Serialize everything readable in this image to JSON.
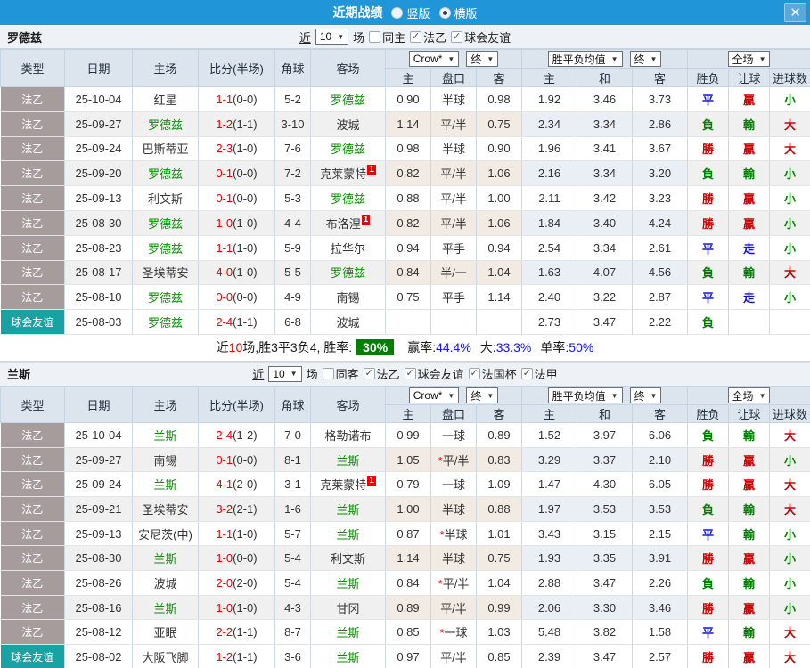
{
  "colors": {
    "accent": "#2095d8",
    "league_type_bg": "#a69c9c",
    "friendly_type_bg": "#17a3a3",
    "team_highlight": "#089000",
    "score_red": "#e80000",
    "badge_bg": "#f40000",
    "rate_badge_bg": "#008000",
    "stat_blue": "#1414e8",
    "result_map": {
      "勝": "#cc0000",
      "負": "#008000",
      "平": "#1414d8",
      "贏": "#cc0000",
      "輸": "#008000",
      "走": "#1414d8",
      "大": "#cc0000",
      "小": "#008000"
    }
  },
  "titlebar": {
    "title": "近期战绩",
    "options": [
      {
        "label": "竖版",
        "selected": false
      },
      {
        "label": "横版",
        "selected": true
      }
    ],
    "close_icon": "✕"
  },
  "controls": {
    "near": "近",
    "count": "10",
    "matches": "场"
  },
  "table_header": {
    "type": "类型",
    "date": "日期",
    "home": "主场",
    "score": "比分(半场)",
    "corner": "角球",
    "away": "客场",
    "odds_select": "Crow*",
    "final_select": "终",
    "avg_select": "胜平负均值",
    "full_select": "全场",
    "sub": [
      "主",
      "盘口",
      "客",
      "主",
      "和",
      "客",
      "胜负",
      "让球",
      "进球数"
    ]
  },
  "teams": [
    {
      "name": "罗德兹",
      "filters": [
        {
          "label": "同主",
          "checked": false
        },
        {
          "label": "法乙",
          "checked": true
        },
        {
          "label": "球会友谊",
          "checked": true
        }
      ],
      "rows": [
        {
          "type": "法乙",
          "cat": "league",
          "date": "25-10-04",
          "home": "红星",
          "home_hl": false,
          "score": "1-1",
          "half": "(0-0)",
          "corner": "5-2",
          "away": "罗德兹",
          "away_hl": true,
          "badge": "",
          "o1": "0.90",
          "hcp": "半球",
          "star": false,
          "o2": "0.98",
          "a1": "1.92",
          "a2": "3.46",
          "a3": "3.73",
          "r1": "平",
          "r2": "贏",
          "r3": "小"
        },
        {
          "type": "法乙",
          "cat": "league",
          "date": "25-09-27",
          "home": "罗德兹",
          "home_hl": true,
          "score": "1-2",
          "half": "(1-1)",
          "corner": "3-10",
          "away": "波城",
          "away_hl": false,
          "badge": "",
          "o1": "1.14",
          "hcp": "平/半",
          "star": false,
          "o2": "0.75",
          "a1": "2.34",
          "a2": "3.34",
          "a3": "2.86",
          "r1": "負",
          "r2": "輸",
          "r3": "大"
        },
        {
          "type": "法乙",
          "cat": "league",
          "date": "25-09-24",
          "home": "巴斯蒂亚",
          "home_hl": false,
          "score": "2-3",
          "half": "(1-0)",
          "corner": "7-6",
          "away": "罗德兹",
          "away_hl": true,
          "badge": "",
          "o1": "0.98",
          "hcp": "半球",
          "star": false,
          "o2": "0.90",
          "a1": "1.96",
          "a2": "3.41",
          "a3": "3.67",
          "r1": "勝",
          "r2": "贏",
          "r3": "大"
        },
        {
          "type": "法乙",
          "cat": "league",
          "date": "25-09-20",
          "home": "罗德兹",
          "home_hl": true,
          "score": "0-1",
          "half": "(0-0)",
          "corner": "7-2",
          "away": "克莱蒙特",
          "away_hl": false,
          "badge": "1",
          "o1": "0.82",
          "hcp": "平/半",
          "star": false,
          "o2": "1.06",
          "a1": "2.16",
          "a2": "3.34",
          "a3": "3.20",
          "r1": "負",
          "r2": "輸",
          "r3": "小"
        },
        {
          "type": "法乙",
          "cat": "league",
          "date": "25-09-13",
          "home": "利文斯",
          "home_hl": false,
          "score": "0-1",
          "half": "(0-0)",
          "corner": "5-3",
          "away": "罗德兹",
          "away_hl": true,
          "badge": "",
          "o1": "0.88",
          "hcp": "平/半",
          "star": false,
          "o2": "1.00",
          "a1": "2.11",
          "a2": "3.42",
          "a3": "3.23",
          "r1": "勝",
          "r2": "贏",
          "r3": "小"
        },
        {
          "type": "法乙",
          "cat": "league",
          "date": "25-08-30",
          "home": "罗德兹",
          "home_hl": true,
          "score": "1-0",
          "half": "(1-0)",
          "corner": "4-4",
          "away": "布洛涅",
          "away_hl": false,
          "badge": "1",
          "o1": "0.82",
          "hcp": "平/半",
          "star": false,
          "o2": "1.06",
          "a1": "1.84",
          "a2": "3.40",
          "a3": "4.24",
          "r1": "勝",
          "r2": "贏",
          "r3": "小"
        },
        {
          "type": "法乙",
          "cat": "league",
          "date": "25-08-23",
          "home": "罗德兹",
          "home_hl": true,
          "score": "1-1",
          "half": "(1-0)",
          "corner": "5-9",
          "away": "拉华尔",
          "away_hl": false,
          "badge": "",
          "o1": "0.94",
          "hcp": "平手",
          "star": false,
          "o2": "0.94",
          "a1": "2.54",
          "a2": "3.34",
          "a3": "2.61",
          "r1": "平",
          "r2": "走",
          "r3": "小"
        },
        {
          "type": "法乙",
          "cat": "league",
          "date": "25-08-17",
          "home": "圣埃蒂安",
          "home_hl": false,
          "score": "4-0",
          "half": "(1-0)",
          "corner": "5-5",
          "away": "罗德兹",
          "away_hl": true,
          "badge": "",
          "o1": "0.84",
          "hcp": "半/一",
          "star": false,
          "o2": "1.04",
          "a1": "1.63",
          "a2": "4.07",
          "a3": "4.56",
          "r1": "負",
          "r2": "輸",
          "r3": "大"
        },
        {
          "type": "法乙",
          "cat": "league",
          "date": "25-08-10",
          "home": "罗德兹",
          "home_hl": true,
          "score": "0-0",
          "half": "(0-0)",
          "corner": "4-9",
          "away": "南锡",
          "away_hl": false,
          "badge": "",
          "o1": "0.75",
          "hcp": "平手",
          "star": false,
          "o2": "1.14",
          "a1": "2.40",
          "a2": "3.22",
          "a3": "2.87",
          "r1": "平",
          "r2": "走",
          "r3": "小"
        },
        {
          "type": "球会友谊",
          "cat": "friendly",
          "date": "25-08-03",
          "home": "罗德兹",
          "home_hl": true,
          "score": "2-4",
          "half": "(1-1)",
          "corner": "6-8",
          "away": "波城",
          "away_hl": false,
          "badge": "",
          "o1": "",
          "hcp": "",
          "star": false,
          "o2": "",
          "a1": "2.73",
          "a2": "3.47",
          "a3": "2.22",
          "r1": "負",
          "r2": "",
          "r3": ""
        }
      ],
      "summary": {
        "near": "近",
        "count": "10",
        "mid": "场,胜3平3负4, 胜率:",
        "rate": "30%",
        "stats": [
          {
            "label": "赢率:",
            "value": "44.4%"
          },
          {
            "label": "大:",
            "value": "33.3%"
          },
          {
            "label": "单率:",
            "value": "50%"
          }
        ]
      }
    },
    {
      "name": "兰斯",
      "filters": [
        {
          "label": "同客",
          "checked": false
        },
        {
          "label": "法乙",
          "checked": true
        },
        {
          "label": "球会友谊",
          "checked": true
        },
        {
          "label": "法国杯",
          "checked": true
        },
        {
          "label": "法甲",
          "checked": true
        }
      ],
      "rows": [
        {
          "type": "法乙",
          "cat": "league",
          "date": "25-10-04",
          "home": "兰斯",
          "home_hl": true,
          "score": "2-4",
          "half": "(1-2)",
          "corner": "7-0",
          "away": "格勒诺布",
          "away_hl": false,
          "badge": "",
          "o1": "0.99",
          "hcp": "一球",
          "star": false,
          "o2": "0.89",
          "a1": "1.52",
          "a2": "3.97",
          "a3": "6.06",
          "r1": "負",
          "r2": "輸",
          "r3": "大"
        },
        {
          "type": "法乙",
          "cat": "league",
          "date": "25-09-27",
          "home": "南锡",
          "home_hl": false,
          "score": "0-1",
          "half": "(0-0)",
          "corner": "8-1",
          "away": "兰斯",
          "away_hl": true,
          "badge": "",
          "o1": "1.05",
          "hcp": "平/半",
          "star": true,
          "o2": "0.83",
          "a1": "3.29",
          "a2": "3.37",
          "a3": "2.10",
          "r1": "勝",
          "r2": "贏",
          "r3": "小"
        },
        {
          "type": "法乙",
          "cat": "league",
          "date": "25-09-24",
          "home": "兰斯",
          "home_hl": true,
          "score": "4-1",
          "half": "(2-0)",
          "corner": "3-1",
          "away": "克莱蒙特",
          "away_hl": false,
          "badge": "1",
          "o1": "0.79",
          "hcp": "一球",
          "star": false,
          "o2": "1.09",
          "a1": "1.47",
          "a2": "4.30",
          "a3": "6.05",
          "r1": "勝",
          "r2": "贏",
          "r3": "大"
        },
        {
          "type": "法乙",
          "cat": "league",
          "date": "25-09-21",
          "home": "圣埃蒂安",
          "home_hl": false,
          "score": "3-2",
          "half": "(2-1)",
          "corner": "1-6",
          "away": "兰斯",
          "away_hl": true,
          "badge": "",
          "o1": "1.00",
          "hcp": "半球",
          "star": false,
          "o2": "0.88",
          "a1": "1.97",
          "a2": "3.53",
          "a3": "3.53",
          "r1": "負",
          "r2": "輸",
          "r3": "大"
        },
        {
          "type": "法乙",
          "cat": "league",
          "date": "25-09-13",
          "home": "安尼茨(中)",
          "home_hl": false,
          "score": "1-1",
          "half": "(1-0)",
          "corner": "5-7",
          "away": "兰斯",
          "away_hl": true,
          "badge": "",
          "o1": "0.87",
          "hcp": "半球",
          "star": true,
          "o2": "1.01",
          "a1": "3.43",
          "a2": "3.15",
          "a3": "2.15",
          "r1": "平",
          "r2": "輸",
          "r3": "小"
        },
        {
          "type": "法乙",
          "cat": "league",
          "date": "25-08-30",
          "home": "兰斯",
          "home_hl": true,
          "score": "1-0",
          "half": "(0-0)",
          "corner": "5-4",
          "away": "利文斯",
          "away_hl": false,
          "badge": "",
          "o1": "1.14",
          "hcp": "半球",
          "star": false,
          "o2": "0.75",
          "a1": "1.93",
          "a2": "3.35",
          "a3": "3.91",
          "r1": "勝",
          "r2": "贏",
          "r3": "小"
        },
        {
          "type": "法乙",
          "cat": "league",
          "date": "25-08-26",
          "home": "波城",
          "home_hl": false,
          "score": "2-0",
          "half": "(2-0)",
          "corner": "5-4",
          "away": "兰斯",
          "away_hl": true,
          "badge": "",
          "o1": "0.84",
          "hcp": "平/半",
          "star": true,
          "o2": "1.04",
          "a1": "2.88",
          "a2": "3.47",
          "a3": "2.26",
          "r1": "負",
          "r2": "輸",
          "r3": "小"
        },
        {
          "type": "法乙",
          "cat": "league",
          "date": "25-08-16",
          "home": "兰斯",
          "home_hl": true,
          "score": "1-0",
          "half": "(1-0)",
          "corner": "4-3",
          "away": "甘冈",
          "away_hl": false,
          "badge": "",
          "o1": "0.89",
          "hcp": "平/半",
          "star": false,
          "o2": "0.99",
          "a1": "2.06",
          "a2": "3.30",
          "a3": "3.46",
          "r1": "勝",
          "r2": "贏",
          "r3": "小"
        },
        {
          "type": "法乙",
          "cat": "league",
          "date": "25-08-12",
          "home": "亚眠",
          "home_hl": false,
          "score": "2-2",
          "half": "(1-1)",
          "corner": "8-7",
          "away": "兰斯",
          "away_hl": true,
          "badge": "",
          "o1": "0.85",
          "hcp": "一球",
          "star": true,
          "o2": "1.03",
          "a1": "5.48",
          "a2": "3.82",
          "a3": "1.58",
          "r1": "平",
          "r2": "輸",
          "r3": "大"
        },
        {
          "type": "球会友谊",
          "cat": "friendly",
          "date": "25-08-02",
          "home": "大阪飞脚",
          "home_hl": false,
          "score": "1-2",
          "half": "(1-1)",
          "corner": "3-6",
          "away": "兰斯",
          "away_hl": true,
          "badge": "",
          "o1": "0.97",
          "hcp": "平/半",
          "star": false,
          "o2": "0.85",
          "a1": "2.39",
          "a2": "3.47",
          "a3": "2.57",
          "r1": "勝",
          "r2": "贏",
          "r3": "大"
        }
      ]
    }
  ]
}
